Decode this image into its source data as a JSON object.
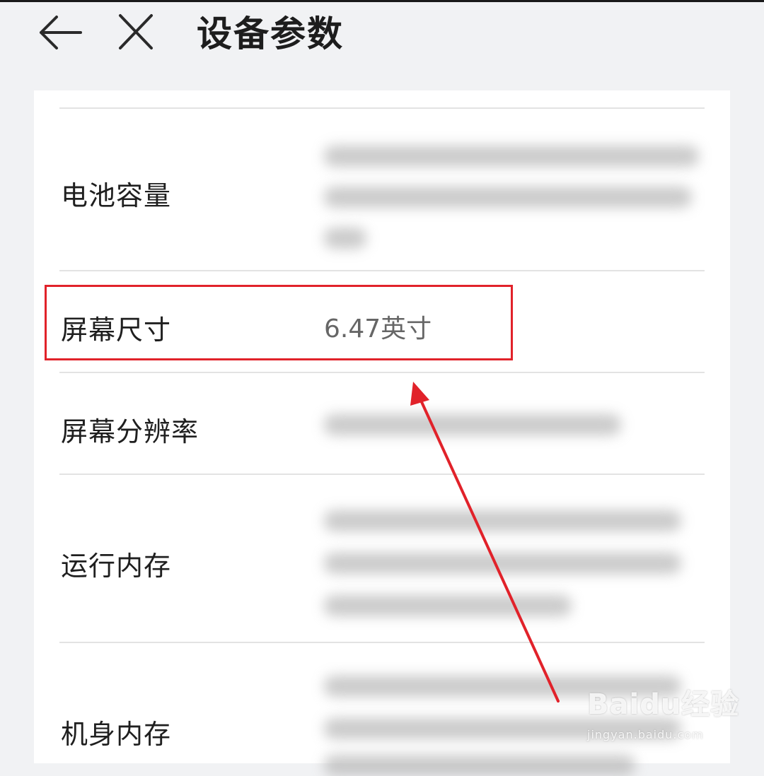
{
  "header": {
    "title": "设备参数",
    "back_icon": "arrow-left-icon",
    "close_icon": "close-icon"
  },
  "specs": [
    {
      "label": "电池容量"
    },
    {
      "label": "屏幕尺寸",
      "value": "6.47英寸"
    },
    {
      "label": "屏幕分辨率"
    },
    {
      "label": "运行内存"
    },
    {
      "label": "机身内存"
    }
  ],
  "annotation": {
    "highlight_color": "#e1222a",
    "arrow_color": "#e1222a"
  },
  "watermark": {
    "brand": "Baidu经验",
    "url": "jingyan.baidu.com"
  }
}
